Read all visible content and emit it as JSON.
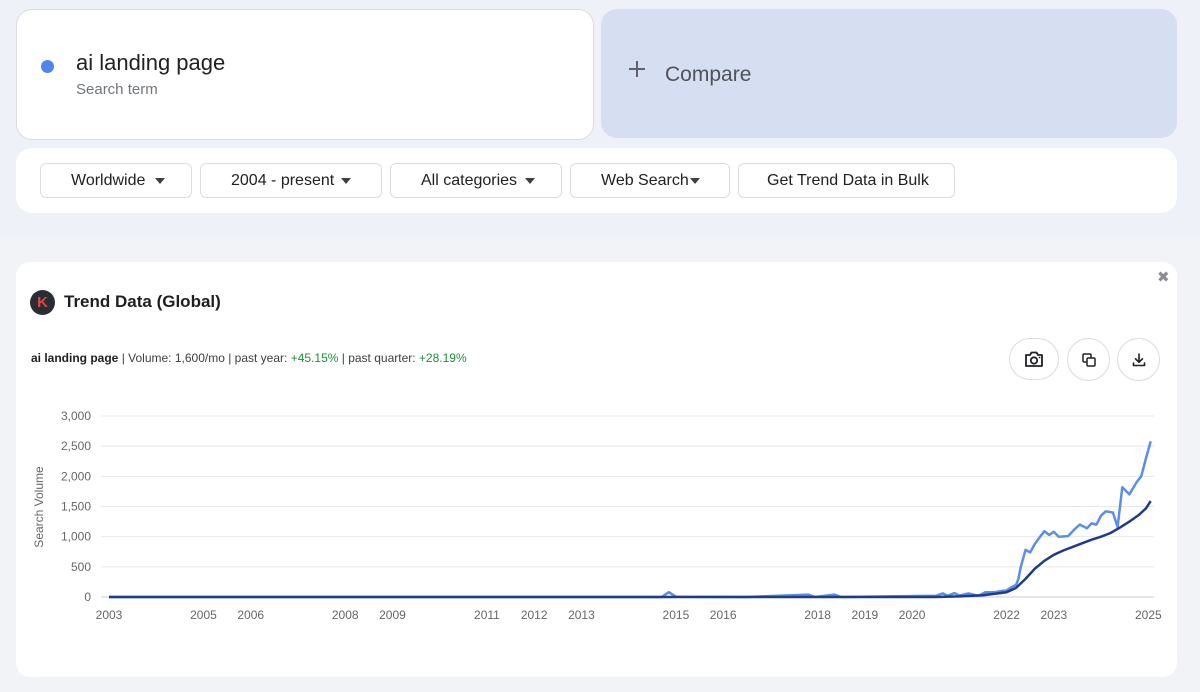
{
  "search": {
    "term": "ai landing page",
    "subtitle": "Search term",
    "dot_color": "#4f86ec"
  },
  "compare": {
    "label": "Compare",
    "icon": "plus-icon"
  },
  "filters": [
    {
      "label": "Worldwide",
      "icon": "caret-down-icon"
    },
    {
      "label": "2004 - present",
      "icon": "caret-down-icon"
    },
    {
      "label": "All categories",
      "icon": "caret-down-icon"
    },
    {
      "label": "Web Search",
      "icon": "caret-down-icon"
    },
    {
      "label": "Get Trend Data in Bulk"
    }
  ],
  "trend_panel": {
    "logo_letter": "K",
    "title": "Trend Data (Global)",
    "close_icon": "close-icon",
    "stats": {
      "keyword": "ai landing page",
      "volume": "| Volume: 1,600/mo | past year: ",
      "past_year": "+45.15%",
      "sep": " | past quarter: ",
      "past_quarter": "+28.19%",
      "positive_color": "#1e8e3e"
    },
    "actions": [
      {
        "name": "camera-icon"
      },
      {
        "name": "copy-icon"
      },
      {
        "name": "download-icon"
      }
    ]
  },
  "chart_data": {
    "type": "line",
    "ylabel": "Search Volume",
    "xlabel": "",
    "ylim": [
      0,
      3000
    ],
    "yticks": [
      0,
      500,
      1000,
      1500,
      2000,
      2500,
      3000
    ],
    "ytick_labels": [
      "0",
      "500",
      "1,000",
      "1,500",
      "2,000",
      "2,500",
      "3,000"
    ],
    "xlim": [
      2003,
      2025.12
    ],
    "xticks": [
      2003,
      2005,
      2006,
      2008,
      2009,
      2011,
      2012,
      2013,
      2015,
      2016,
      2018,
      2019,
      2020,
      2022,
      2023,
      2025
    ],
    "grid": true,
    "legend": "none",
    "series": [
      {
        "color": "#5b8ee6",
        "points": [
          [
            2003,
            0
          ],
          [
            2014.7,
            0
          ],
          [
            2014.85,
            80
          ],
          [
            2015.0,
            5
          ],
          [
            2016.5,
            0
          ],
          [
            2017.8,
            40
          ],
          [
            2017.95,
            0
          ],
          [
            2018.35,
            40
          ],
          [
            2018.5,
            0
          ],
          [
            2019.5,
            10
          ],
          [
            2020.5,
            20
          ],
          [
            2020.65,
            60
          ],
          [
            2020.75,
            20
          ],
          [
            2020.9,
            65
          ],
          [
            2021.0,
            25
          ],
          [
            2021.2,
            60
          ],
          [
            2021.4,
            20
          ],
          [
            2021.55,
            80
          ],
          [
            2021.75,
            80
          ],
          [
            2021.9,
            100
          ],
          [
            2022.0,
            110
          ],
          [
            2022.1,
            160
          ],
          [
            2022.2,
            200
          ],
          [
            2022.25,
            300
          ],
          [
            2022.3,
            500
          ],
          [
            2022.4,
            780
          ],
          [
            2022.5,
            740
          ],
          [
            2022.6,
            880
          ],
          [
            2022.7,
            990
          ],
          [
            2022.8,
            1090
          ],
          [
            2022.9,
            1030
          ],
          [
            2023.0,
            1080
          ],
          [
            2023.1,
            1000
          ],
          [
            2023.3,
            1010
          ],
          [
            2023.45,
            1130
          ],
          [
            2023.55,
            1200
          ],
          [
            2023.7,
            1140
          ],
          [
            2023.8,
            1220
          ],
          [
            2023.9,
            1200
          ],
          [
            2024.0,
            1350
          ],
          [
            2024.1,
            1420
          ],
          [
            2024.25,
            1400
          ],
          [
            2024.35,
            1160
          ],
          [
            2024.45,
            1820
          ],
          [
            2024.6,
            1700
          ],
          [
            2024.75,
            1900
          ],
          [
            2024.85,
            2000
          ],
          [
            2024.95,
            2300
          ],
          [
            2025.05,
            2580
          ]
        ]
      },
      {
        "color": "#1f3c88",
        "points": [
          [
            2003,
            0
          ],
          [
            2020.5,
            0
          ],
          [
            2021.0,
            10
          ],
          [
            2021.5,
            30
          ],
          [
            2022.0,
            80
          ],
          [
            2022.2,
            150
          ],
          [
            2022.4,
            300
          ],
          [
            2022.6,
            470
          ],
          [
            2022.8,
            600
          ],
          [
            2023.0,
            700
          ],
          [
            2023.2,
            770
          ],
          [
            2023.5,
            860
          ],
          [
            2023.8,
            950
          ],
          [
            2024.0,
            1000
          ],
          [
            2024.2,
            1060
          ],
          [
            2024.4,
            1150
          ],
          [
            2024.6,
            1250
          ],
          [
            2024.8,
            1360
          ],
          [
            2024.95,
            1470
          ],
          [
            2025.05,
            1590
          ]
        ]
      }
    ]
  }
}
